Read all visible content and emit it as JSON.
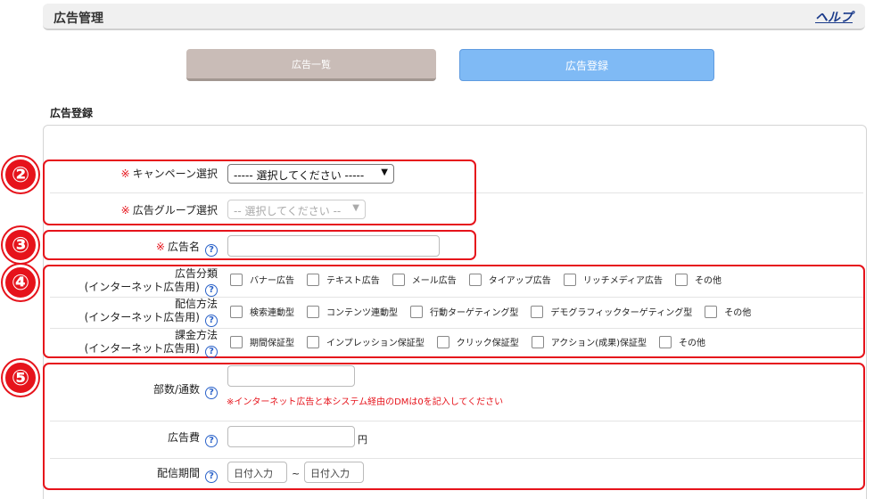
{
  "header": {
    "title": "広告管理",
    "help": "ヘルプ"
  },
  "tabs": {
    "list": "広告一覧",
    "register": "広告登録"
  },
  "section_title": "広告登録",
  "markers": [
    "②",
    "③",
    "④",
    "⑤"
  ],
  "required_mark": "※",
  "help_icon": "?",
  "campaign": {
    "label": "キャンペーン選択",
    "value": "----- 選択してください -----"
  },
  "adgroup": {
    "label": "広告グループ選択",
    "value": "-- 選択してください --"
  },
  "adname": {
    "label": "広告名"
  },
  "category": {
    "label1": "広告分類",
    "label2": "(インターネット広告用)",
    "options": [
      "バナー広告",
      "テキスト広告",
      "メール広告",
      "タイアップ広告",
      "リッチメディア広告",
      "その他"
    ]
  },
  "delivery": {
    "label1": "配信方法",
    "label2": "(インターネット広告用)",
    "options": [
      "検索連動型",
      "コンテンツ連動型",
      "行動ターゲティング型",
      "デモグラフィックターゲティング型",
      "その他"
    ]
  },
  "billing": {
    "label1": "課金方法",
    "label2": "(インターネット広告用)",
    "options": [
      "期間保証型",
      "インプレッション保証型",
      "クリック保証型",
      "アクション(成果)保証型",
      "その他"
    ]
  },
  "copies": {
    "label": "部数/通数",
    "note": "※インターネット広告と本システム経由のDMは0を記入してください"
  },
  "cost": {
    "label": "広告費",
    "unit": "円"
  },
  "period": {
    "label": "配信期間",
    "start_placeholder": "日付入力",
    "end_placeholder": "日付入力",
    "tilde": "~"
  }
}
